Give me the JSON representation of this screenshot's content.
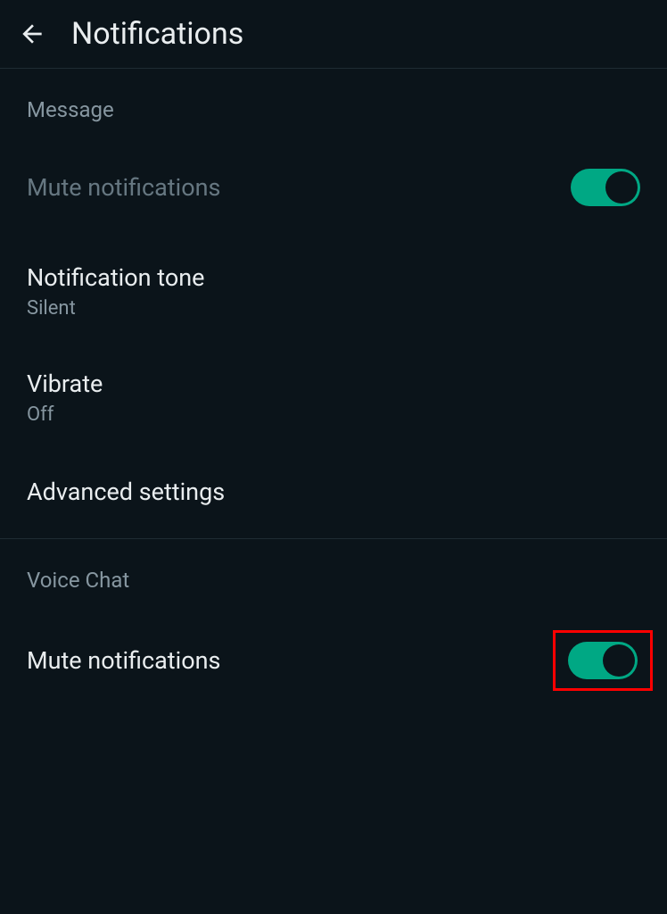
{
  "header": {
    "title": "Notifications"
  },
  "sections": {
    "message": {
      "header": "Message",
      "mute": {
        "label": "Mute notifications"
      },
      "tone": {
        "label": "Notification tone",
        "value": "Silent"
      },
      "vibrate": {
        "label": "Vibrate",
        "value": "Off"
      },
      "advanced": {
        "label": "Advanced settings"
      }
    },
    "voiceChat": {
      "header": "Voice Chat",
      "mute": {
        "label": "Mute notifications"
      }
    }
  }
}
